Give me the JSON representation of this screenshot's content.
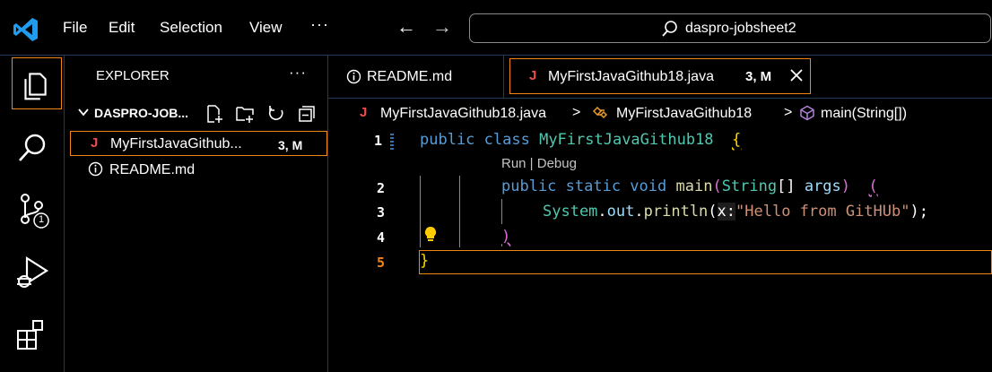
{
  "titlebar": {
    "menus": [
      "File",
      "Edit",
      "Selection",
      "View"
    ],
    "more": "···",
    "back_arrow": "←",
    "forward_arrow": "→",
    "command_center": "daspro-jobsheet2"
  },
  "activity_bar": {
    "icons": [
      "explorer-icon",
      "search-icon",
      "source-control-icon",
      "run-debug-icon",
      "extensions-icon"
    ],
    "scm_badge": "1"
  },
  "sidebar": {
    "title": "EXPLORER",
    "more": "···",
    "folder": "DASPRO-JOB...",
    "files": [
      {
        "icon": "J",
        "name": "MyFirstJavaGithub...",
        "badge": "3, M"
      },
      {
        "icon": "info-icon",
        "name": "README.md"
      }
    ]
  },
  "editor": {
    "tabs": [
      {
        "name": "README.md"
      },
      {
        "icon": "J",
        "name": "MyFirstJavaGithub18.java",
        "badge": "3, M",
        "close": "×"
      }
    ],
    "breadcrumb": {
      "j": "J",
      "file": "MyFirstJavaGithub18.java",
      "sep": ">",
      "class": "MyFirstJavaGithub18",
      "method": "main(String[])"
    },
    "codelens": "Run | Debug",
    "line_numbers": [
      "1",
      "2",
      "3",
      "4",
      "5"
    ],
    "code": {
      "l1_kw": "public class",
      "l1_cls": "MyFirstJavaGithub18",
      "l1_brace": "{",
      "l2_kw": "public static void",
      "l2_fn": "main",
      "l2_paren_open": "(",
      "l2_type": "String",
      "l2_rest": "[] ",
      "l2_var": "args",
      "l2_paren_close": ")",
      "l2_brace": "(",
      "l3_cls": "System",
      "l3_dot1": ".",
      "l3_var": "out",
      "l3_dot2": ".",
      "l3_fn": "println",
      "l3_paren": "(",
      "l3_hint": "x:",
      "l3_str": "\"Hello from GitHUb\"",
      "l3_end": ");",
      "l4_brace": ")",
      "l5_brace": "}"
    }
  },
  "colors": {
    "focus_border": "#f38518",
    "java_icon": "#f14c4c",
    "keyword": "#569cd6",
    "class": "#4ec9b0"
  }
}
